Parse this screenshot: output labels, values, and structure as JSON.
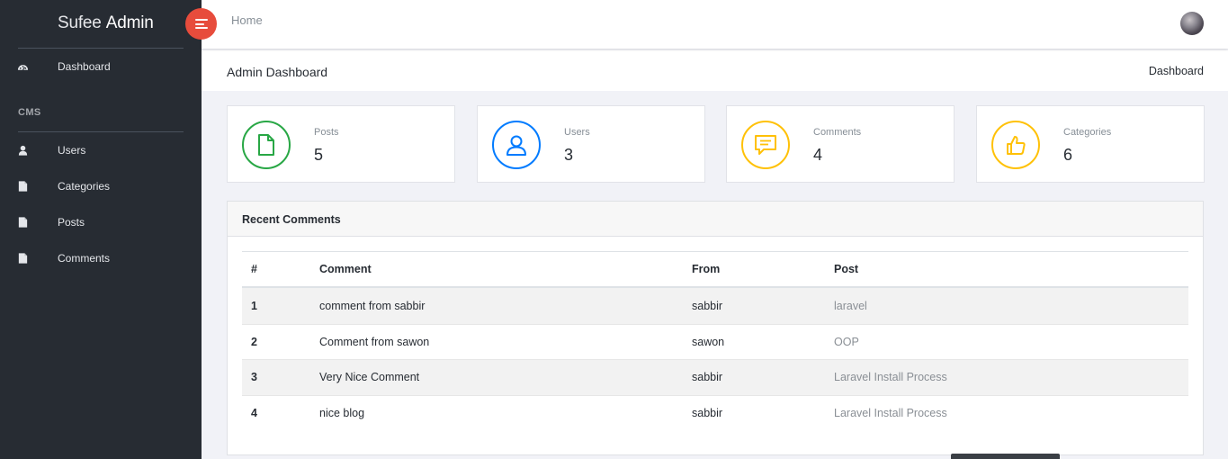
{
  "brand": {
    "light": "Sufee ",
    "bold": "Admin"
  },
  "sidebar": {
    "items": [
      {
        "label": "Dashboard",
        "icon": "dashboard-icon"
      },
      {
        "label": "Users",
        "icon": "user-icon"
      },
      {
        "label": "Categories",
        "icon": "file-icon"
      },
      {
        "label": "Posts",
        "icon": "file-icon"
      },
      {
        "label": "Comments",
        "icon": "file-icon"
      }
    ],
    "section_title": "CMS"
  },
  "header": {
    "home_link": "Home"
  },
  "breadcrumb": {
    "page_title": "Admin Dashboard",
    "current": "Dashboard"
  },
  "stats": [
    {
      "label": "Posts",
      "value": "5",
      "color": "#28a745",
      "icon": "document-icon"
    },
    {
      "label": "Users",
      "value": "3",
      "color": "#007bff",
      "icon": "user-icon"
    },
    {
      "label": "Comments",
      "value": "4",
      "color": "#ffc107",
      "icon": "comment-icon"
    },
    {
      "label": "Categories",
      "value": "6",
      "color": "#ffc107",
      "icon": "thumbs-up-icon"
    }
  ],
  "recent_comments": {
    "title": "Recent Comments",
    "columns": [
      "#",
      "Comment",
      "From",
      "Post"
    ],
    "rows": [
      {
        "id": "1",
        "comment": "comment from sabbir",
        "from": "sabbir",
        "post": "laravel"
      },
      {
        "id": "2",
        "comment": "Comment from sawon",
        "from": "sawon",
        "post": "OOP"
      },
      {
        "id": "3",
        "comment": "Very Nice Comment",
        "from": "sabbir",
        "post": "Laravel Install Process"
      },
      {
        "id": "4",
        "comment": "nice blog",
        "from": "sabbir",
        "post": "Laravel Install Process"
      }
    ]
  },
  "colors": {
    "sidebar_bg": "#272c33",
    "toggle_accent": "#e74c3c",
    "page_bg": "#f1f2f7"
  }
}
